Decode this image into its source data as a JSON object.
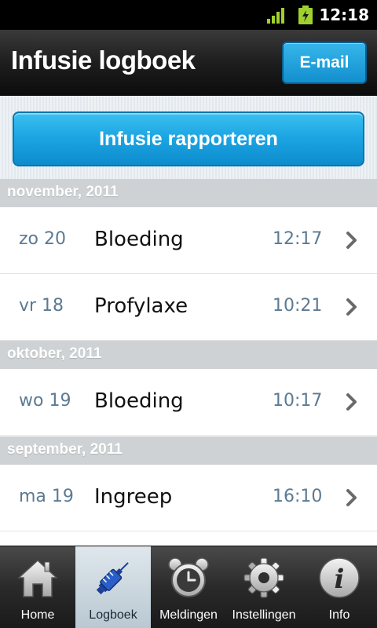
{
  "status_bar": {
    "time": "12:18",
    "signal_icon": "signal-icon",
    "battery_icon": "battery-charging-icon"
  },
  "header": {
    "title": "Infusie logboek",
    "email_label": "E-mail"
  },
  "report_button": {
    "label": "Infusie rapporteren"
  },
  "groups": [
    {
      "month": "november, 2011",
      "entries": [
        {
          "date": "zo 20",
          "type": "Bloeding",
          "time": "12:17"
        },
        {
          "date": "vr 18",
          "type": "Profylaxe",
          "time": "10:21"
        }
      ]
    },
    {
      "month": "oktober, 2011",
      "entries": [
        {
          "date": "wo 19",
          "type": "Bloeding",
          "time": "10:17"
        }
      ]
    },
    {
      "month": "september, 2011",
      "entries": [
        {
          "date": "ma 19",
          "type": "Ingreep",
          "time": "16:10"
        }
      ]
    }
  ],
  "tabbar": {
    "active_tab": "Logboek",
    "tabs": [
      {
        "label": "Home",
        "icon": "home-icon"
      },
      {
        "label": "Logboek",
        "icon": "syringe-icon"
      },
      {
        "label": "Meldingen",
        "icon": "alarm-clock-icon"
      },
      {
        "label": "Instellingen",
        "icon": "gear-icon"
      },
      {
        "label": "Info",
        "icon": "info-icon"
      }
    ]
  },
  "colors": {
    "accent": "#1aa3e2",
    "date_text": "#5c7a92",
    "header_band": "#cfd2d4",
    "title_bar": "#1e1e1e"
  }
}
